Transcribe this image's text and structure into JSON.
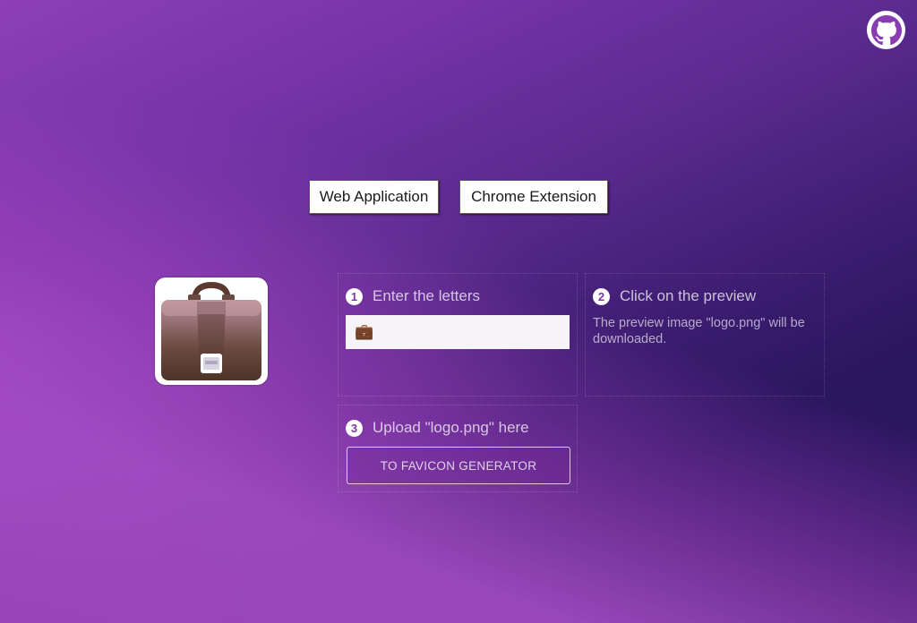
{
  "header": {
    "github_icon": "github-octocat-icon"
  },
  "modes": {
    "web_label": "Web Application",
    "extension_label": "Chrome Extension"
  },
  "preview": {
    "icon": "briefcase-icon"
  },
  "steps": [
    {
      "number": "1",
      "title": "Enter the letters",
      "input_value": "💼"
    },
    {
      "number": "2",
      "title": "Click on the preview",
      "description": "The preview image \"logo.png\" will be downloaded."
    },
    {
      "number": "3",
      "title": "Upload \"logo.png\" here",
      "button_label": "TO FAVICON GENERATOR"
    }
  ],
  "colors": {
    "background_start": "#9a44c0",
    "background_end": "#2b1660",
    "step_badge": "#ffffff"
  }
}
